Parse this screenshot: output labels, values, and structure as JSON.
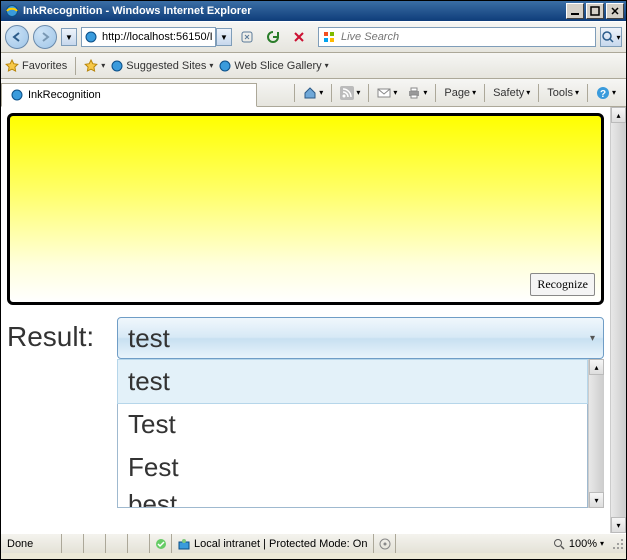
{
  "window": {
    "title": "InkRecognition - Windows Internet Explorer"
  },
  "nav": {
    "url": "http://localhost:56150/I",
    "search_placeholder": "Live Search"
  },
  "favbar": {
    "label": "Favorites",
    "suggested": "Suggested Sites",
    "webslice": "Web Slice Gallery"
  },
  "tab": {
    "name": "InkRecognition"
  },
  "commands": {
    "page": "Page",
    "safety": "Safety",
    "tools": "Tools"
  },
  "inkpanel": {
    "recognize": "Recognize"
  },
  "result": {
    "label": "Result:",
    "selected": "test",
    "options": [
      "test",
      "Test",
      "Fest",
      "best"
    ]
  },
  "status": {
    "done": "Done",
    "zone": "Local intranet | Protected Mode: On",
    "zoom": "100%"
  }
}
